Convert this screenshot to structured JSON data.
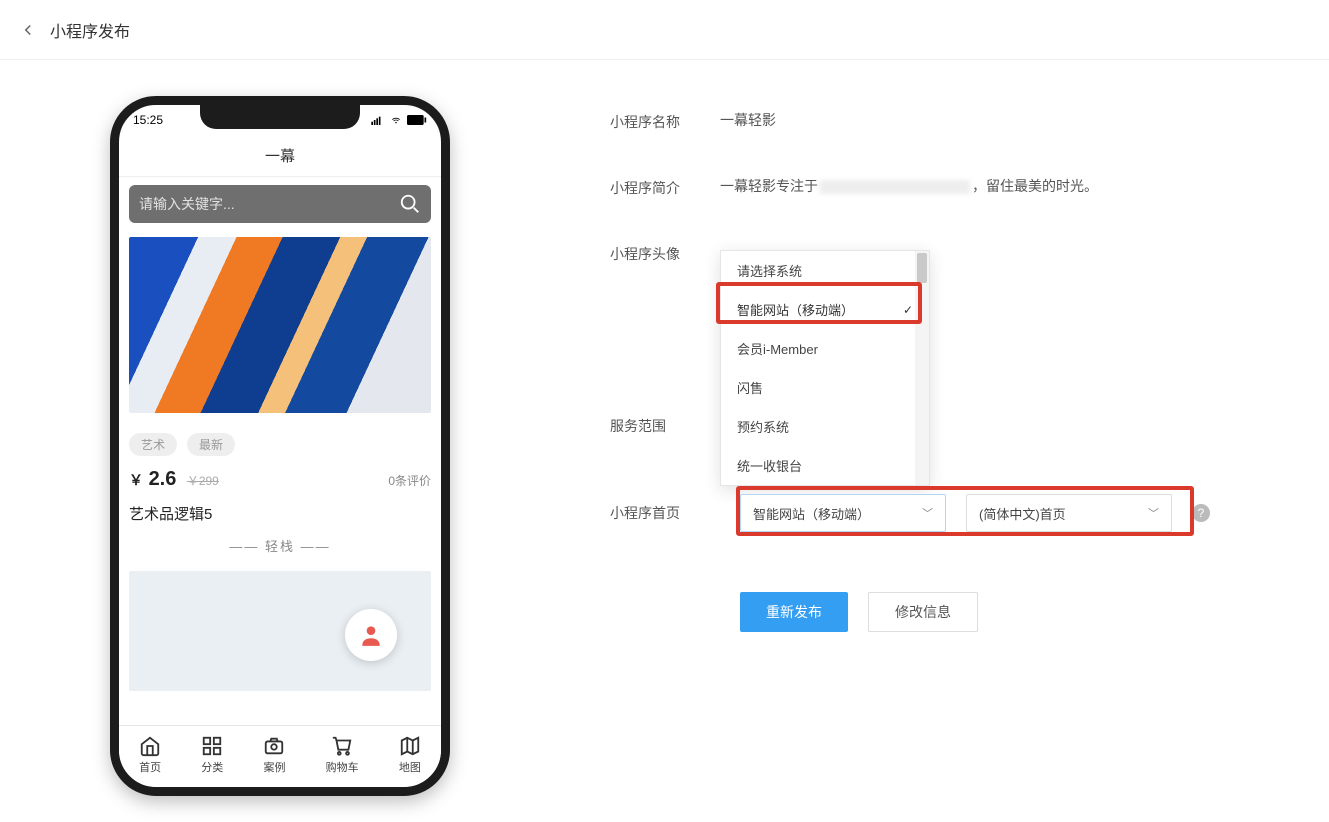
{
  "header": {
    "title": "小程序发布"
  },
  "phone": {
    "time": "15:25",
    "appTitle": "一幕",
    "searchPlaceholder": "请输入关键字...",
    "tags": [
      "艺术",
      "最新"
    ],
    "priceCurrency": "￥",
    "price": "2.6",
    "oldPrice": "￥299",
    "reviews": "0条评价",
    "productTitle": "艺术品逻辑5",
    "productSub": "—— 轻栈 ——",
    "tabs": [
      {
        "icon": "home",
        "label": "首页"
      },
      {
        "icon": "grid",
        "label": "分类"
      },
      {
        "icon": "camera",
        "label": "案例"
      },
      {
        "icon": "cart",
        "label": "购物车"
      },
      {
        "icon": "map",
        "label": "地图"
      }
    ]
  },
  "form": {
    "fields": {
      "nameLabel": "小程序名称",
      "nameValue": "一幕轻影",
      "descLabel": "小程序简介",
      "descPrefix": "一幕轻影专注于",
      "descSuffix": "，留住最美的时光。",
      "avatarLabel": "小程序头像",
      "scopeLabel": "服务范围",
      "homeLabel": "小程序首页"
    },
    "systemDropdown": {
      "placeholder": "请选择系统",
      "options": [
        "智能网站（移动端）",
        "会员i-Member",
        "闪售",
        "预约系统",
        "统一收银台"
      ],
      "selectedIndex": 0
    },
    "homeSelects": {
      "select1": "智能网站（移动端）",
      "select2": "(简体中文)首页"
    },
    "buttons": {
      "primary": "重新发布",
      "secondary": "修改信息"
    }
  }
}
